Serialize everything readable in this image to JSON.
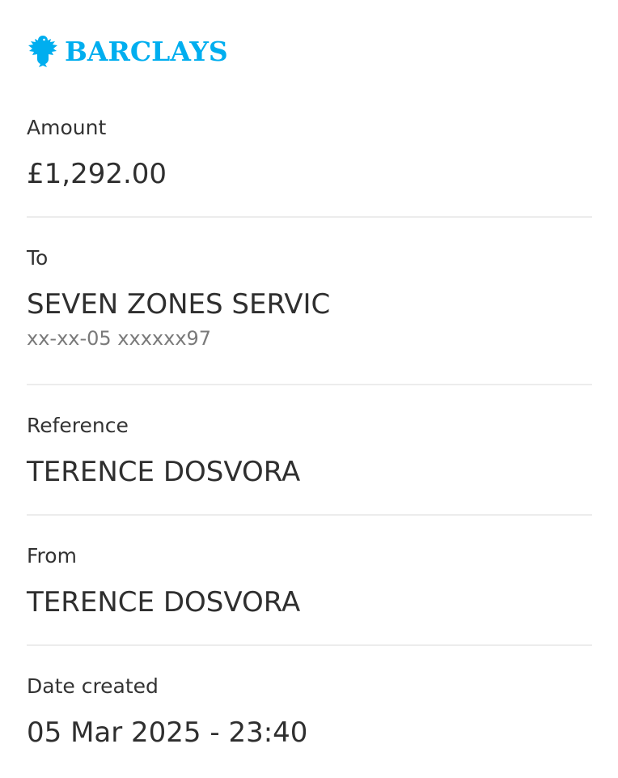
{
  "brand": {
    "name": "BARCLAYS",
    "color": "#00aeef",
    "icon": "eagle-icon"
  },
  "fields": {
    "amount": {
      "label": "Amount",
      "value": "£1,292.00"
    },
    "to": {
      "label": "To",
      "value": "SEVEN ZONES SERVIC",
      "account": "xx-xx-05 xxxxxx97"
    },
    "reference": {
      "label": "Reference",
      "value": "TERENCE DOSVORA"
    },
    "from": {
      "label": "From",
      "value": "TERENCE DOSVORA"
    },
    "date_created": {
      "label": "Date created",
      "value": "05 Mar 2025 - 23:40"
    }
  }
}
